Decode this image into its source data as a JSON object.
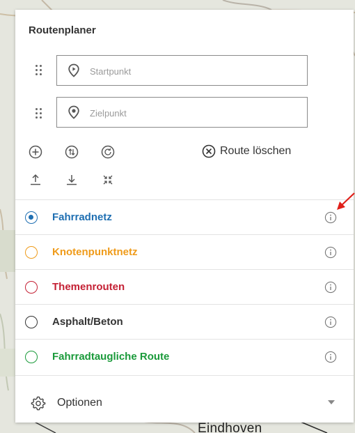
{
  "map": {
    "place_label": "Eindhoven"
  },
  "planner": {
    "title": "Routenplaner",
    "start_placeholder": "Startpunkt",
    "end_placeholder": "Zielpunkt",
    "clear_route_label": "Route löschen"
  },
  "networks": [
    {
      "label": "Fahrradnetz",
      "color": "#1f6fb2",
      "selected": true
    },
    {
      "label": "Knotenpunktnetz",
      "color": "#ef9b1a",
      "selected": false
    },
    {
      "label": "Themenrouten",
      "color": "#c42034",
      "selected": false
    },
    {
      "label": "Asphalt/Beton",
      "color": "#333333",
      "selected": false
    },
    {
      "label": "Fahrradtaugliche Route",
      "color": "#1a9a3a",
      "selected": false
    }
  ],
  "options": {
    "label": "Optionen"
  },
  "icons": {
    "drag": "drag-handle-icon",
    "start": "start-pin-icon",
    "end": "end-pin-icon",
    "add": "plus-circle-icon",
    "reverse": "swap-circle-icon",
    "refresh": "refresh-circle-icon",
    "clear": "close-circle-icon",
    "upload": "upload-icon",
    "download": "download-icon",
    "collapse": "collapse-icon",
    "info": "info-icon",
    "gear": "gear-icon",
    "caret": "caret-down-icon",
    "annotation": "red-arrow-icon"
  }
}
